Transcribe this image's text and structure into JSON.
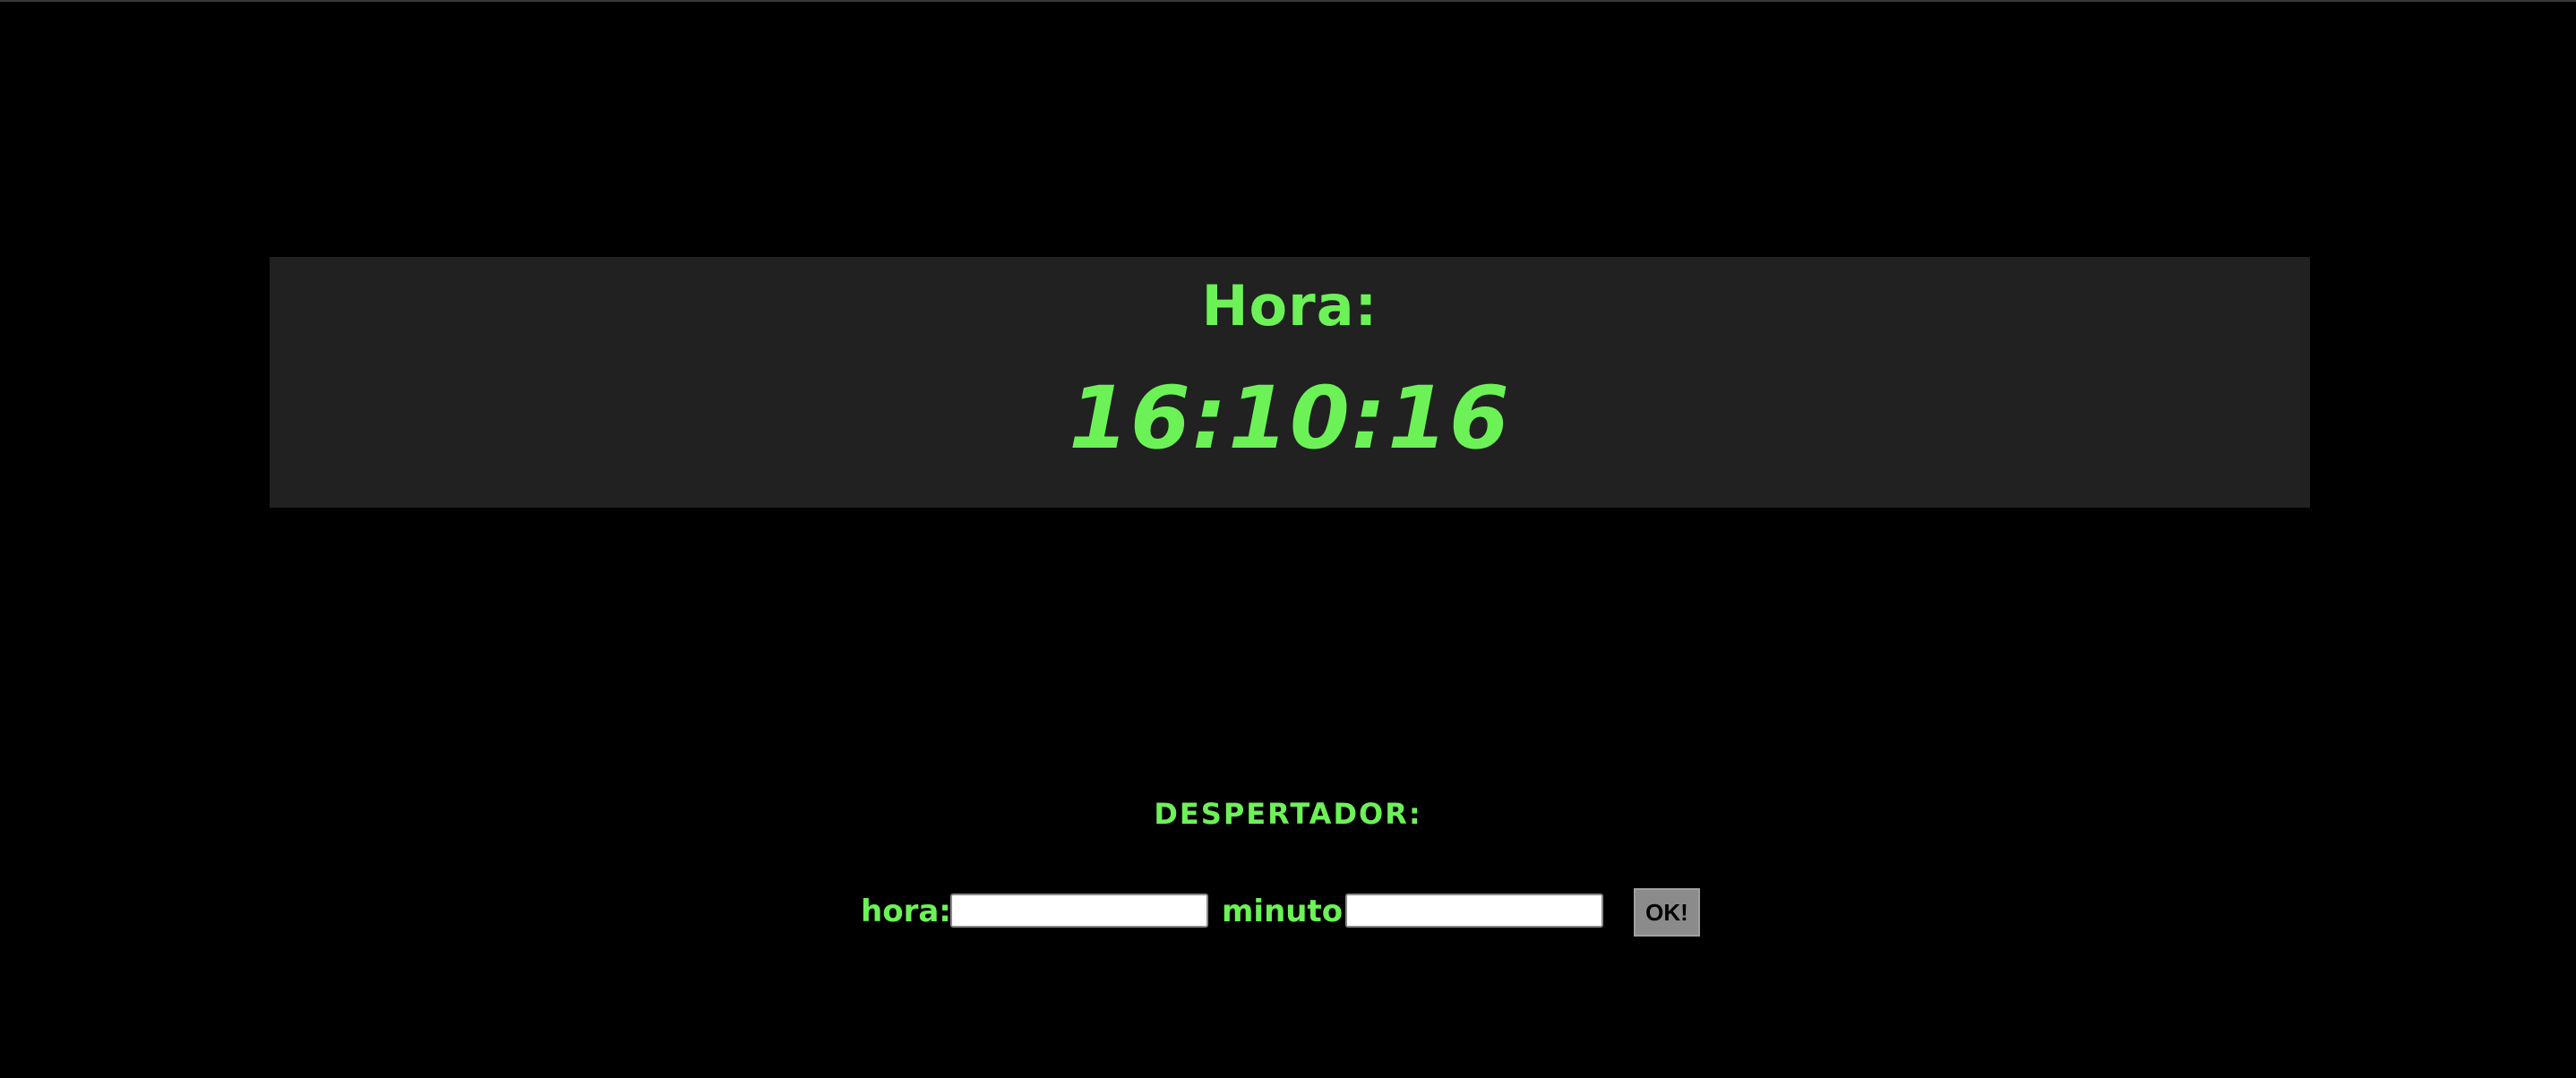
{
  "colors": {
    "background": "#000000",
    "panel": "#212121",
    "accent_green": "#6cf257",
    "button_bg": "#8b8b8b"
  },
  "clock": {
    "label": "Hora:",
    "time": "16:10:16"
  },
  "alarm": {
    "title": "DESPERTADOR:",
    "hour_label": "hora:",
    "hour_value": "",
    "minute_label": "minuto:",
    "minute_value": "",
    "submit_label": "OK!"
  }
}
